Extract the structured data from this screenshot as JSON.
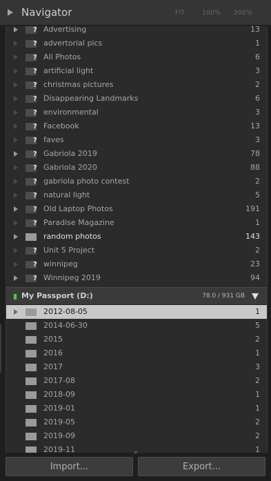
{
  "navigator": {
    "title": "Navigator",
    "zoom_fit": "FIT",
    "zoom_100": "100%",
    "zoom_200": "200%"
  },
  "folders": [
    {
      "name": "Advertising",
      "count": "13",
      "expand": "solid",
      "style": "missing"
    },
    {
      "name": "advertorial pics",
      "count": "1",
      "expand": "faint",
      "style": "missing"
    },
    {
      "name": "All Photos",
      "count": "6",
      "expand": "faint",
      "style": "missing"
    },
    {
      "name": "artificial light",
      "count": "3",
      "expand": "faint",
      "style": "missing"
    },
    {
      "name": "christmas pictures",
      "count": "2",
      "expand": "faint",
      "style": "missing"
    },
    {
      "name": "Disappearing Landmarks",
      "count": "6",
      "expand": "faint",
      "style": "missing"
    },
    {
      "name": "environmental",
      "count": "3",
      "expand": "faint",
      "style": "missing"
    },
    {
      "name": "Facebook",
      "count": "13",
      "expand": "faint",
      "style": "missing"
    },
    {
      "name": "faves",
      "count": "3",
      "expand": "faint",
      "style": "missing"
    },
    {
      "name": "Gabriola 2019",
      "count": "78",
      "expand": "solid",
      "style": "missing"
    },
    {
      "name": "Gabriola 2020",
      "count": "88",
      "expand": "faint",
      "style": "missing"
    },
    {
      "name": "gabriola photo contest",
      "count": "2",
      "expand": "faint",
      "style": "missing"
    },
    {
      "name": "natural light",
      "count": "5",
      "expand": "faint",
      "style": "missing"
    },
    {
      "name": "Old Laptop Photos",
      "count": "191",
      "expand": "solid",
      "style": "missing"
    },
    {
      "name": "Paradise Magazine",
      "count": "1",
      "expand": "faint",
      "style": "missing"
    },
    {
      "name": "random photos",
      "count": "143",
      "expand": "solid",
      "style": "online"
    },
    {
      "name": "Unit 5 Project",
      "count": "2",
      "expand": "faint",
      "style": "missing"
    },
    {
      "name": "winnipeg",
      "count": "23",
      "expand": "faint",
      "style": "missing"
    },
    {
      "name": "Winnipeg 2019",
      "count": "94",
      "expand": "solid",
      "style": "missing"
    }
  ],
  "volume": {
    "name": "My Passport (D:)",
    "space": "78.0 / 931 GB",
    "status_color": "#5fb85f"
  },
  "volume_folders": [
    {
      "name": "2012-08-05",
      "count": "1",
      "expand": "dotted",
      "selected": true
    },
    {
      "name": "2014-06-30",
      "count": "5",
      "expand": "none",
      "selected": false
    },
    {
      "name": "2015",
      "count": "2",
      "expand": "none",
      "selected": false
    },
    {
      "name": "2016",
      "count": "1",
      "expand": "none",
      "selected": false
    },
    {
      "name": "2017",
      "count": "3",
      "expand": "none",
      "selected": false
    },
    {
      "name": "2017-08",
      "count": "2",
      "expand": "none",
      "selected": false
    },
    {
      "name": "2018-09",
      "count": "1",
      "expand": "none",
      "selected": false
    },
    {
      "name": "2019-01",
      "count": "1",
      "expand": "none",
      "selected": false
    },
    {
      "name": "2019-05",
      "count": "2",
      "expand": "none",
      "selected": false
    },
    {
      "name": "2019-09",
      "count": "2",
      "expand": "none",
      "selected": false
    },
    {
      "name": "2019-11",
      "count": "1",
      "expand": "none",
      "selected": false
    }
  ],
  "buttons": {
    "import": "Import...",
    "export": "Export..."
  }
}
